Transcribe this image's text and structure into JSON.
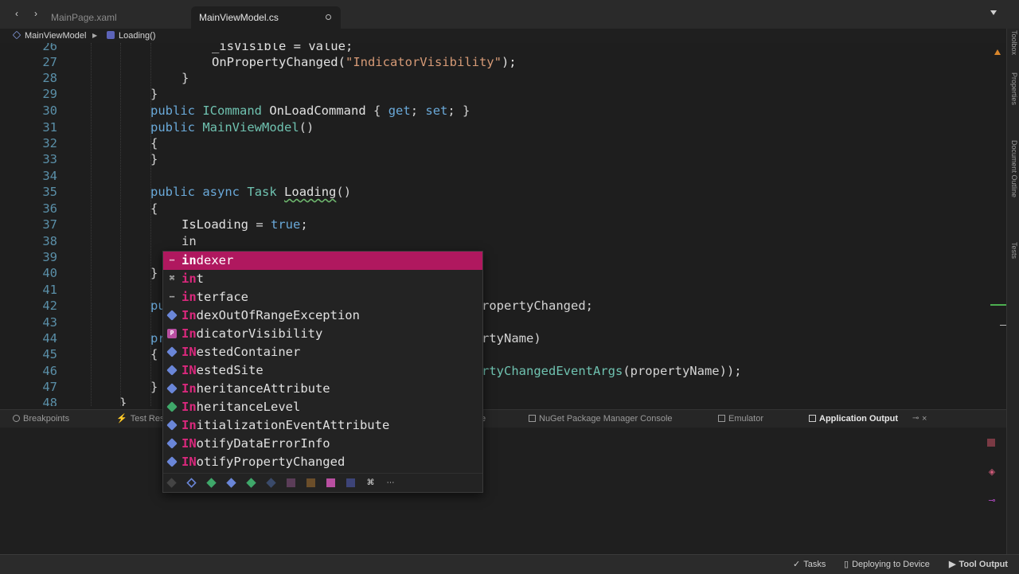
{
  "tabs": [
    {
      "label": "MainPage.xaml",
      "active": false
    },
    {
      "label": "MainViewModel.cs",
      "active": true
    }
  ],
  "breadcrumb": [
    "MainViewModel",
    "Loading()"
  ],
  "code_lines": [
    {
      "num": "26",
      "indent": 8
    },
    {
      "num": "27",
      "indent": 8
    },
    {
      "num": "28",
      "indent": 6
    },
    {
      "num": "29",
      "indent": 4
    },
    {
      "num": "30",
      "indent": 4
    },
    {
      "num": "31",
      "indent": 4
    },
    {
      "num": "32",
      "indent": 4
    },
    {
      "num": "33",
      "indent": 4
    },
    {
      "num": "34",
      "indent": 0
    },
    {
      "num": "35",
      "indent": 4
    },
    {
      "num": "36",
      "indent": 4
    },
    {
      "num": "37",
      "indent": 6
    },
    {
      "num": "38",
      "indent": 6
    },
    {
      "num": "39",
      "indent": 0
    },
    {
      "num": "40",
      "indent": 4
    },
    {
      "num": "41",
      "indent": 0
    },
    {
      "num": "42",
      "indent": 4
    },
    {
      "num": "43",
      "indent": 0
    },
    {
      "num": "44",
      "indent": 4
    },
    {
      "num": "45",
      "indent": 4
    },
    {
      "num": "46",
      "indent": 6
    },
    {
      "num": "47",
      "indent": 4
    },
    {
      "num": "48",
      "indent": 2
    }
  ],
  "code_text": {
    "l26": "_isVisible = value;",
    "l27_call": "OnPropertyChanged(",
    "l27_str": "\"IndicatorVisibility\"",
    "l27_end": ");",
    "brace_close": "}",
    "brace_open": "{",
    "l30_kw": "public",
    "l30_type": "ICommand",
    "l30_name": "OnLoadCommand",
    "l30_rest_open": "{",
    "l30_get": "get",
    "l30_set": "set",
    "l31_kw": "public",
    "l31_name": "MainViewModel",
    "l31_parens": "()",
    "l35_kw1": "public",
    "l35_kw2": "async",
    "l35_type": "Task",
    "l35_name": "Loading",
    "l35_parens": "()",
    "l37_name": "IsLoading",
    "l37_eq": " = ",
    "l37_val": "true",
    "l37_semi": ";",
    "l38": "in",
    "l42_kw": "pu",
    "l42_tail": "ropertyChanged;",
    "l44_kw": "pr",
    "l44_tail": "rtyName)",
    "l46_tail_type": "rtyChangedEventArgs",
    "l46_tail_rest": "(propertyName));"
  },
  "completion": {
    "typed": "in",
    "items": [
      {
        "icon": "snippet-icon",
        "glyph": "⋯",
        "prefix": "in",
        "rest": "dexer",
        "selected": true
      },
      {
        "icon": "keyword-icon",
        "glyph": "⌘",
        "prefix": "in",
        "rest": "t",
        "selected": false
      },
      {
        "icon": "snippet-icon",
        "glyph": "⋯",
        "prefix": "in",
        "rest": "terface",
        "selected": false
      },
      {
        "icon": "class-icon",
        "glyph": "",
        "prefix": "In",
        "rest": "dexOutOfRangeException",
        "selected": false
      },
      {
        "icon": "property-icon",
        "glyph": "P",
        "prefix": "In",
        "rest": "dicatorVisibility",
        "selected": false
      },
      {
        "icon": "interface-icon",
        "glyph": "",
        "prefix": "IN",
        "rest": "estedContainer",
        "selected": false
      },
      {
        "icon": "interface-icon",
        "glyph": "",
        "prefix": "IN",
        "rest": "estedSite",
        "selected": false
      },
      {
        "icon": "class-icon",
        "glyph": "",
        "prefix": "In",
        "rest": "heritanceAttribute",
        "selected": false
      },
      {
        "icon": "enum-icon",
        "glyph": "",
        "prefix": "In",
        "rest": "heritanceLevel",
        "selected": false
      },
      {
        "icon": "class-icon",
        "glyph": "",
        "prefix": "In",
        "rest": "itializationEventAttribute",
        "selected": false
      },
      {
        "icon": "interface-icon",
        "glyph": "",
        "prefix": "IN",
        "rest": "otifyDataErrorInfo",
        "selected": false
      },
      {
        "icon": "interface-icon",
        "glyph": "",
        "prefix": "IN",
        "rest": "otifyPropertyChanged",
        "selected": false
      }
    ],
    "filters": [
      "namespace-filter-icon",
      "class-filter-icon",
      "struct-filter-icon",
      "interface-filter-icon",
      "enum-filter-icon",
      "delegate-filter-icon",
      "field-filter-icon",
      "event-filter-icon",
      "property-filter-icon",
      "method-filter-icon",
      "keyword-filter-icon",
      "snippet-filter-icon"
    ]
  },
  "panel_tabs": {
    "breakpoints": "Breakpoints",
    "test_results": "Test Res",
    "hidden_tail": "e",
    "nuget": "NuGet Package Manager Console",
    "emulator": "Emulator",
    "app_output": "Application Output"
  },
  "right_strip": [
    "Toolbox",
    "Properties",
    "Document Outline",
    "Tests"
  ],
  "status": {
    "tasks": "Tasks",
    "deploying": "Deploying to Device",
    "tool_output": "Tool Output"
  },
  "colors": {
    "accent": "#b0185f",
    "keyword": "#6aa9d9",
    "type": "#6fc2b0",
    "string": "#d69a76"
  }
}
